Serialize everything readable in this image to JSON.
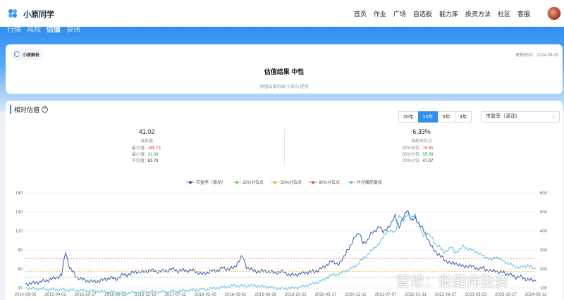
{
  "header": {
    "brand": "小原同学",
    "nav": [
      "首页",
      "作业",
      "广场",
      "自选股",
      "能力库",
      "投资方法",
      "社区",
      "客服"
    ]
  },
  "tabs": [
    {
      "label": "行情",
      "active": false
    },
    {
      "label": "风险",
      "active": false
    },
    {
      "label": "估值",
      "active": true
    },
    {
      "label": "资讯",
      "active": false
    }
  ],
  "ai_card": {
    "chip": "小原解析",
    "update_time": "更新时间：2024-09-05",
    "result": "估值结果  中性",
    "provider": "估值结果均由 小原AI 提供"
  },
  "valuation": {
    "title": "相对估值",
    "periods": [
      {
        "label": "20年",
        "active": false
      },
      {
        "label": "10年",
        "active": true
      },
      {
        "label": "5年",
        "active": false
      },
      {
        "label": "3年",
        "active": false
      }
    ],
    "metric_select": "市盈率（滚动）",
    "left": {
      "value": "41.02",
      "label": "当前值",
      "rows": [
        {
          "k": "最大值:",
          "v": "155.73",
          "color": "red"
        },
        {
          "k": "最小值:",
          "v": "31.06",
          "color": "green"
        },
        {
          "k": "平均值:",
          "v": "63.78",
          "color": "dark"
        }
      ]
    },
    "right": {
      "value": "6.33%",
      "label": "当前分位点",
      "rows": [
        {
          "k": "80%分位:",
          "v": "76.65",
          "color": "red"
        },
        {
          "k": "50%分位:",
          "v": "55.99",
          "color": "green"
        },
        {
          "k": "20%分位:",
          "v": "47.07",
          "color": "dark"
        }
      ]
    }
  },
  "legend": [
    {
      "name": "市盈率（滚动）",
      "color": "#3d5bb5"
    },
    {
      "name": "20%分位点",
      "color": "#7ecb5f"
    },
    {
      "name": "50%分位点",
      "color": "#f5b93c"
    },
    {
      "name": "80%分位点",
      "color": "#e5544f"
    },
    {
      "name": "片仔癀前复权",
      "color": "#67c1e6"
    }
  ],
  "watermark": "雪球：张健伟投资",
  "chart_data": {
    "type": "line",
    "x_ticks": [
      "2014-09-05",
      "2015-04-02",
      "2015-10-27",
      "2016-05-22",
      "2016-12-16",
      "2017-07-12",
      "2018-02-05",
      "2018-09-01",
      "2019-03-28",
      "2019-10-22",
      "2020-05-17",
      "2020-12-11",
      "2021-07-07",
      "2022-01-31",
      "2022-08-27",
      "2023-03-23",
      "2023-10-17",
      "2024-05-12"
    ],
    "y_left_ticks": [
      "180",
      "150",
      "120",
      "90",
      "60",
      "30"
    ],
    "y_right_ticks": [
      "600",
      "500",
      "400",
      "300",
      "200",
      "100"
    ],
    "y_left_range": [
      30,
      180
    ],
    "y_right_range": [
      100,
      600
    ],
    "grid": true,
    "pe_points": [
      [
        0,
        36
      ],
      [
        8,
        40
      ],
      [
        14,
        45
      ],
      [
        18,
        50
      ],
      [
        20,
        88
      ],
      [
        22,
        62
      ],
      [
        26,
        46
      ],
      [
        30,
        42
      ],
      [
        34,
        40
      ],
      [
        38,
        42
      ],
      [
        42,
        46
      ],
      [
        45,
        44
      ],
      [
        48,
        50
      ],
      [
        52,
        52
      ],
      [
        55,
        56
      ],
      [
        58,
        55
      ],
      [
        62,
        58
      ],
      [
        66,
        56
      ],
      [
        70,
        57
      ],
      [
        73,
        60
      ],
      [
        76,
        57
      ],
      [
        80,
        58
      ],
      [
        84,
        57
      ],
      [
        88,
        52
      ],
      [
        92,
        56
      ],
      [
        96,
        58
      ],
      [
        98,
        62
      ],
      [
        100,
        60
      ],
      [
        104,
        62
      ],
      [
        106,
        72
      ],
      [
        108,
        80
      ],
      [
        110,
        64
      ],
      [
        113,
        58
      ],
      [
        116,
        56
      ],
      [
        120,
        57
      ],
      [
        124,
        54
      ],
      [
        128,
        56
      ],
      [
        132,
        50
      ],
      [
        136,
        52
      ],
      [
        140,
        55
      ],
      [
        144,
        56
      ],
      [
        148,
        62
      ],
      [
        152,
        72
      ],
      [
        156,
        68
      ],
      [
        158,
        75
      ],
      [
        160,
        90
      ],
      [
        162,
        96
      ],
      [
        164,
        112
      ],
      [
        166,
        118
      ],
      [
        168,
        100
      ],
      [
        170,
        105
      ],
      [
        172,
        115
      ],
      [
        174,
        120
      ],
      [
        176,
        128
      ],
      [
        178,
        118
      ],
      [
        180,
        125
      ],
      [
        182,
        130
      ],
      [
        184,
        145
      ],
      [
        186,
        125
      ],
      [
        188,
        140
      ],
      [
        190,
        155
      ],
      [
        192,
        135
      ],
      [
        194,
        142
      ],
      [
        196,
        130
      ],
      [
        198,
        122
      ],
      [
        200,
        110
      ],
      [
        202,
        95
      ],
      [
        204,
        88
      ],
      [
        206,
        82
      ],
      [
        208,
        76
      ],
      [
        210,
        72
      ],
      [
        212,
        68
      ],
      [
        214,
        70
      ],
      [
        216,
        66
      ],
      [
        218,
        64
      ],
      [
        220,
        65
      ],
      [
        222,
        64
      ],
      [
        224,
        62
      ],
      [
        226,
        60
      ],
      [
        228,
        62
      ],
      [
        230,
        58
      ],
      [
        232,
        56
      ],
      [
        234,
        58
      ],
      [
        236,
        54
      ],
      [
        238,
        55
      ],
      [
        240,
        52
      ],
      [
        242,
        50
      ],
      [
        244,
        47
      ],
      [
        246,
        48
      ],
      [
        248,
        45
      ],
      [
        250,
        44
      ],
      [
        252,
        42
      ],
      [
        254,
        41
      ]
    ],
    "price_points": [
      [
        0,
        30
      ],
      [
        10,
        28
      ],
      [
        20,
        27
      ],
      [
        30,
        26
      ],
      [
        40,
        24
      ],
      [
        50,
        22
      ],
      [
        60,
        24
      ],
      [
        70,
        24
      ],
      [
        80,
        26
      ],
      [
        90,
        28
      ],
      [
        100,
        32
      ],
      [
        104,
        34
      ],
      [
        108,
        33
      ],
      [
        112,
        34
      ],
      [
        116,
        33
      ],
      [
        120,
        32
      ],
      [
        124,
        30
      ],
      [
        128,
        29
      ],
      [
        132,
        30
      ],
      [
        136,
        31
      ],
      [
        140,
        34
      ],
      [
        144,
        38
      ],
      [
        148,
        42
      ],
      [
        152,
        50
      ],
      [
        156,
        52
      ],
      [
        160,
        58
      ],
      [
        164,
        64
      ],
      [
        168,
        76
      ],
      [
        172,
        88
      ],
      [
        176,
        100
      ],
      [
        180,
        120
      ],
      [
        184,
        118
      ],
      [
        186,
        145
      ],
      [
        188,
        135
      ],
      [
        190,
        148
      ],
      [
        192,
        140
      ],
      [
        194,
        146
      ],
      [
        196,
        128
      ],
      [
        198,
        112
      ],
      [
        200,
        118
      ],
      [
        202,
        110
      ],
      [
        204,
        100
      ],
      [
        206,
        96
      ],
      [
        208,
        86
      ],
      [
        210,
        90
      ],
      [
        212,
        94
      ],
      [
        214,
        86
      ],
      [
        216,
        90
      ],
      [
        218,
        96
      ],
      [
        220,
        92
      ],
      [
        222,
        90
      ],
      [
        224,
        88
      ],
      [
        226,
        84
      ],
      [
        228,
        80
      ],
      [
        230,
        78
      ],
      [
        232,
        74
      ],
      [
        234,
        80
      ],
      [
        236,
        76
      ],
      [
        238,
        72
      ],
      [
        240,
        70
      ],
      [
        242,
        66
      ],
      [
        244,
        64
      ],
      [
        246,
        62
      ],
      [
        248,
        64
      ],
      [
        250,
        66
      ],
      [
        252,
        62
      ],
      [
        254,
        60
      ]
    ],
    "percentile_80": 76.65,
    "percentile_50": 55.99,
    "percentile_20": 47.07
  }
}
